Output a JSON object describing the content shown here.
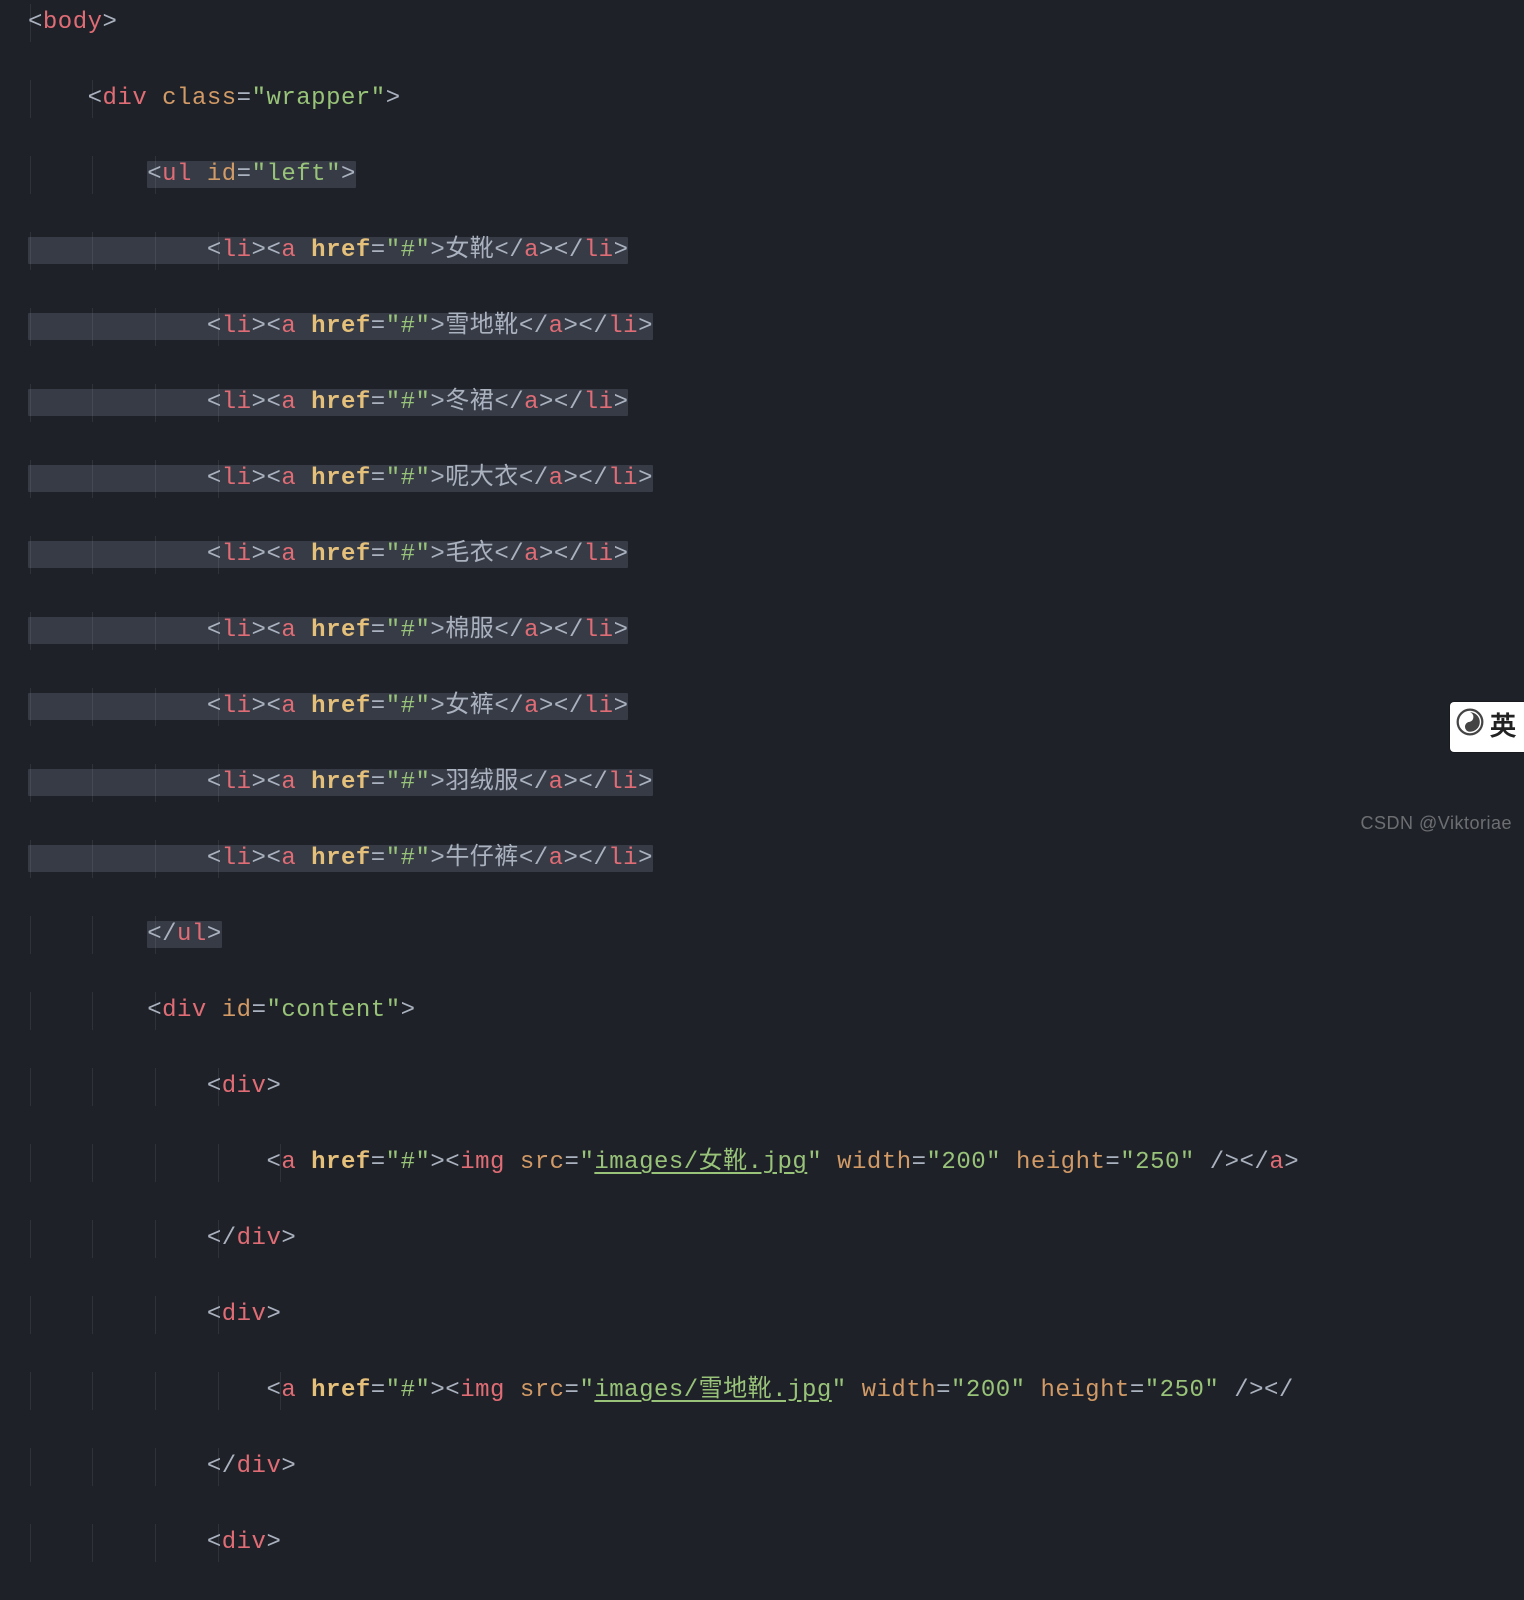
{
  "code": {
    "bodyOpen": "body",
    "wrapperTag": "div",
    "wrapperAttr": "class",
    "wrapperVal": "\"wrapper\"",
    "ulTag": "ul",
    "ulAttr": "id",
    "ulVal": "\"left\"",
    "liTag": "li",
    "aTag": "a",
    "hrefAttr": "href",
    "hrefVal": "\"#\"",
    "items": [
      "女靴",
      "雪地靴",
      "冬裙",
      "呢大衣",
      "毛衣",
      "棉服",
      "女裤",
      "羽绒服",
      "牛仔裤"
    ],
    "contentTag": "div",
    "contentAttr": "id",
    "contentVal": "\"content\"",
    "innerDiv": "div",
    "imgTag": "img",
    "srcAttr": "src",
    "imgSrc1": "images/女靴.jpg",
    "imgSrc2": "images/雪地靴.jpg",
    "widthAttr": "width",
    "widthVal": "\"200\"",
    "heightAttr": "height",
    "heightVal": "\"250\""
  },
  "watermark": "CSDN @Viktoriae",
  "ime": "英"
}
